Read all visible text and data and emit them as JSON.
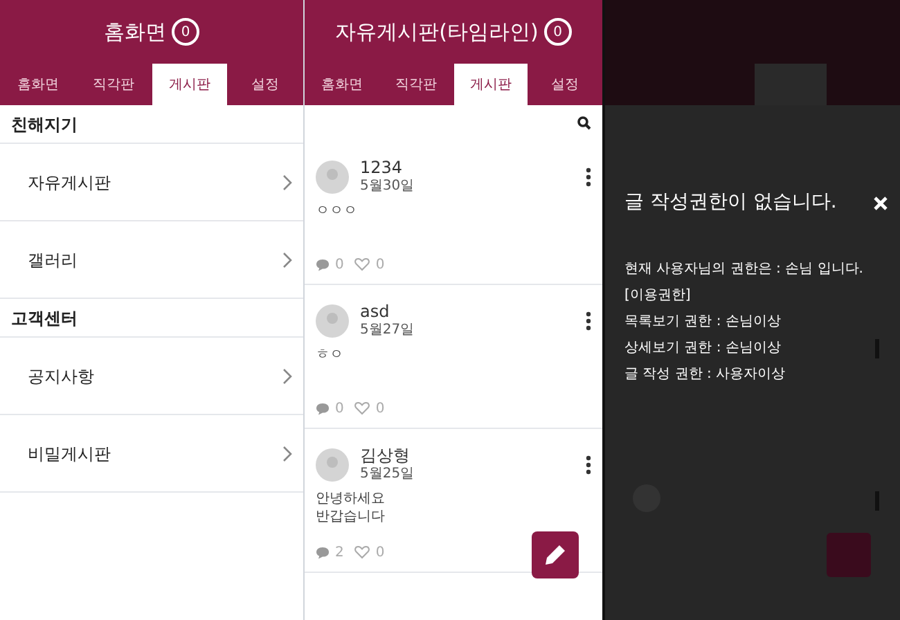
{
  "home_screen": {
    "header": {
      "title": "홈화면",
      "badge": "0"
    },
    "tabs": [
      {
        "label": "홈화면",
        "selected": false
      },
      {
        "label": "직각판",
        "selected": false
      },
      {
        "label": "게시판",
        "selected": true
      },
      {
        "label": "설정",
        "selected": false
      }
    ],
    "sections": [
      {
        "title": "친해지기",
        "items": [
          {
            "label": "자유게시판"
          },
          {
            "label": "갤러리"
          }
        ]
      },
      {
        "title": "고객센터",
        "items": [
          {
            "label": "공지사항"
          },
          {
            "label": "비밀게시판"
          }
        ]
      }
    ]
  },
  "board_screen": {
    "header": {
      "title": "자유게시판(타임라인)",
      "badge": "0"
    },
    "tabs": [
      {
        "label": "홈화면",
        "selected": false
      },
      {
        "label": "직각판",
        "selected": false
      },
      {
        "label": "게시판",
        "selected": true
      },
      {
        "label": "설정",
        "selected": false
      }
    ],
    "posts": [
      {
        "author": "1234",
        "date": "5월30일",
        "body": [
          "ㅇㅇㅇ"
        ],
        "comments": "0",
        "likes": "0"
      },
      {
        "author": "asd",
        "date": "5월27일",
        "body": [
          "ㅎㅇ"
        ],
        "comments": "0",
        "likes": "0"
      },
      {
        "author": "김상형",
        "date": "5월25일",
        "body": [
          "안녕하세요",
          "반갑습니다"
        ],
        "comments": "2",
        "likes": "0"
      }
    ]
  },
  "permission_dialog": {
    "title": "글 작성권한이 없습니다.",
    "message": "현재 사용자님의 권한은 : 손님 입니다.",
    "lines": [
      "[이용권한]",
      "목록보기 권한 : 손님이상",
      "상세보기 권한 : 손님이상",
      "글 작성 권한 : 사용자이상"
    ]
  }
}
